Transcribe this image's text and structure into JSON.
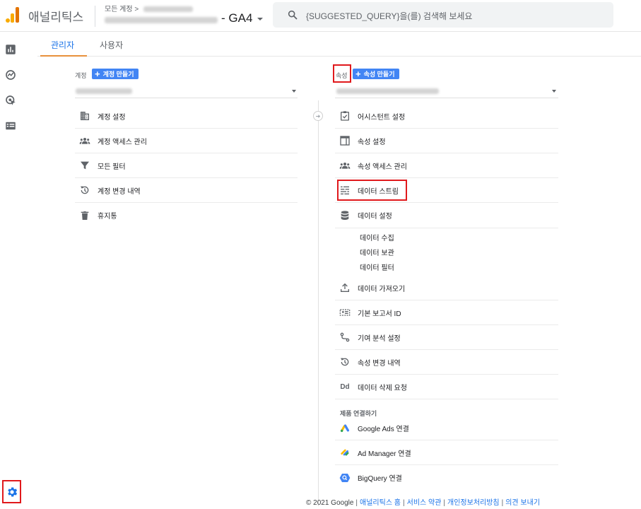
{
  "app": {
    "name": "애널리틱스"
  },
  "header": {
    "account_crumb": "모든 계정 >",
    "property_title": "- GA4",
    "search_placeholder": "{SUGGESTED_QUERY}을(를) 검색해 보세요"
  },
  "tabs": [
    {
      "label": "관리자",
      "active": true
    },
    {
      "label": "사용자",
      "active": false
    }
  ],
  "account_column": {
    "label": "계정",
    "create_button": "계정 만들기",
    "items": [
      {
        "label": "계정 설정",
        "icon": "building-icon"
      },
      {
        "label": "계정 액세스 관리",
        "icon": "people-icon"
      },
      {
        "label": "모든 필터",
        "icon": "filter-icon"
      },
      {
        "label": "계정 변경 내역",
        "icon": "history-icon"
      },
      {
        "label": "휴지통",
        "icon": "trash-icon"
      }
    ]
  },
  "property_column": {
    "label": "속성",
    "create_button": "속성 만들기",
    "items": [
      {
        "label": "어시스턴트 설정",
        "icon": "checklist-icon"
      },
      {
        "label": "속성 설정",
        "icon": "window-icon"
      },
      {
        "label": "속성 액세스 관리",
        "icon": "people-icon"
      },
      {
        "label": "데이터 스트림",
        "icon": "stream-icon"
      },
      {
        "label": "데이터 설정",
        "icon": "database-icon"
      }
    ],
    "data_settings_sub": [
      "데이터 수집",
      "데이터 보관",
      "데이터 필터"
    ],
    "more_items": [
      {
        "label": "데이터 가져오기",
        "icon": "upload-icon"
      },
      {
        "label": "기본 보고서 ID",
        "icon": "id-card-icon"
      },
      {
        "label": "기여 분석 설정",
        "icon": "attribution-icon"
      },
      {
        "label": "속성 변경 내역",
        "icon": "history-icon"
      },
      {
        "label": "데이터 삭제 요청",
        "icon": "dd-icon"
      }
    ],
    "product_links_heading": "제품 연결하기",
    "product_links": [
      {
        "label": "Google Ads 연결",
        "icon": "google-ads-icon"
      },
      {
        "label": "Ad Manager 연결",
        "icon": "ad-manager-icon"
      },
      {
        "label": "BigQuery 연결",
        "icon": "bigquery-icon"
      }
    ]
  },
  "footer": {
    "copyright": "© 2021 Google",
    "links": [
      "애널리틱스 홈",
      "서비스 약관",
      "개인정보처리방침",
      "의견 보내기"
    ]
  },
  "colors": {
    "accent": "#1a73e8",
    "button": "#4285f4",
    "highlight": "#e0191c",
    "tab_indicator": "#e8913c"
  }
}
